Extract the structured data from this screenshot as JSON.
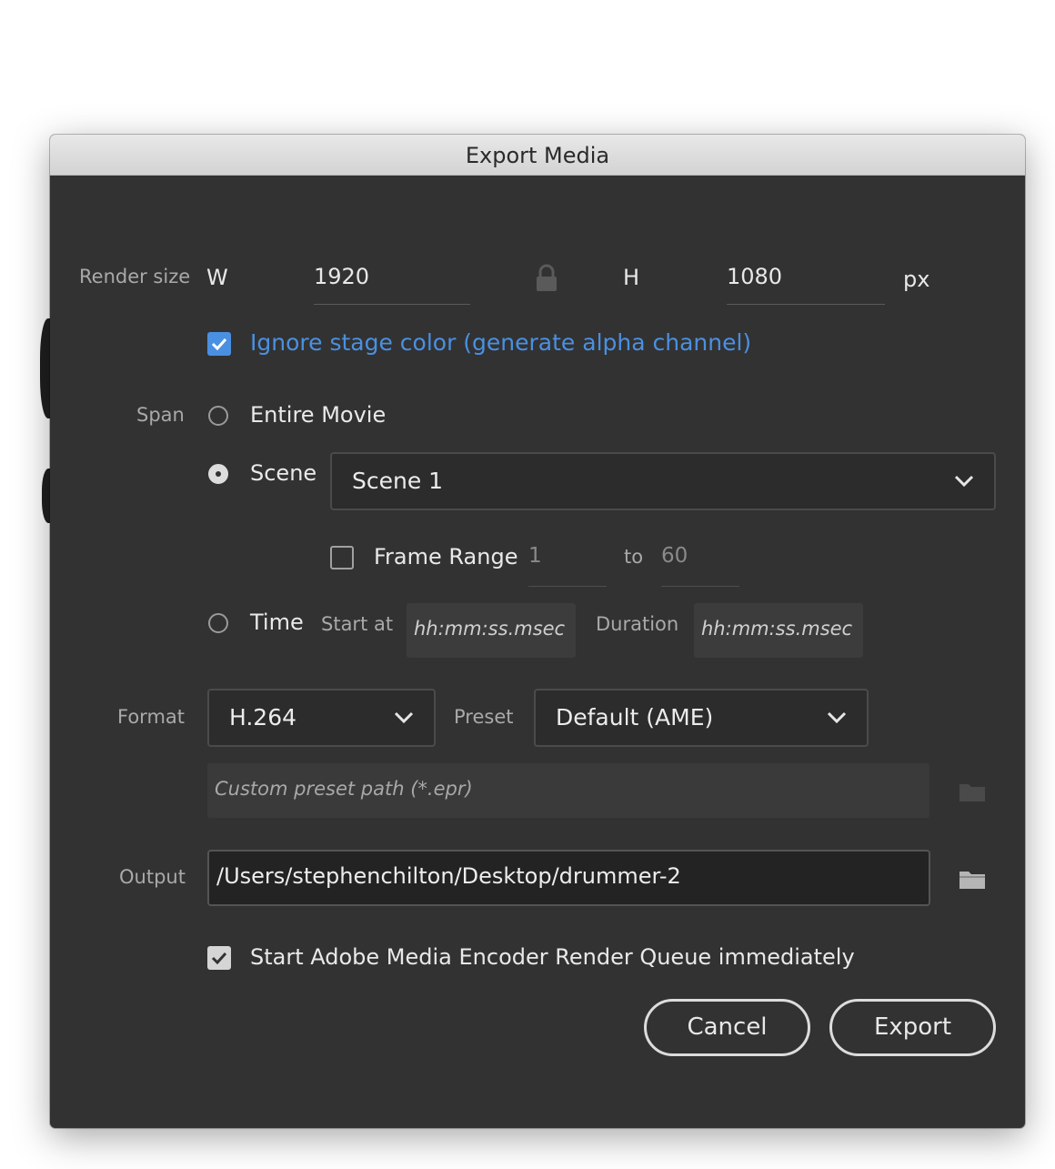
{
  "window": {
    "title": "Export Media"
  },
  "render_size": {
    "label": "Render size",
    "w_label": "W",
    "width": "1920",
    "h_label": "H",
    "height": "1080",
    "unit": "px",
    "lock_icon": "lock-icon"
  },
  "ignore_stage": {
    "label": "Ignore stage color (generate alpha channel)",
    "checked": true,
    "accent": "#4a90e2"
  },
  "span": {
    "label": "Span",
    "entire_movie": "Entire Movie",
    "scene_label": "Scene",
    "scene_selected": "Scene 1",
    "frame_range_label": "Frame Range",
    "frame_from": "1",
    "to_label": "to",
    "frame_to": "60",
    "time_label": "Time",
    "start_at_label": "Start at",
    "start_placeholder": "hh:mm:ss.msec",
    "duration_label": "Duration",
    "duration_placeholder": "hh:mm:ss.msec",
    "selected": "scene"
  },
  "format": {
    "label": "Format",
    "value": "H.264",
    "preset_label": "Preset",
    "preset_value": "Default (AME)",
    "custom_preset_placeholder": "Custom preset path (*.epr)"
  },
  "output": {
    "label": "Output",
    "path": "/Users/stephenchilton/Desktop/drummer-2"
  },
  "start_queue": {
    "label": "Start Adobe Media Encoder Render Queue immediately",
    "checked": true
  },
  "buttons": {
    "cancel": "Cancel",
    "export": "Export"
  }
}
